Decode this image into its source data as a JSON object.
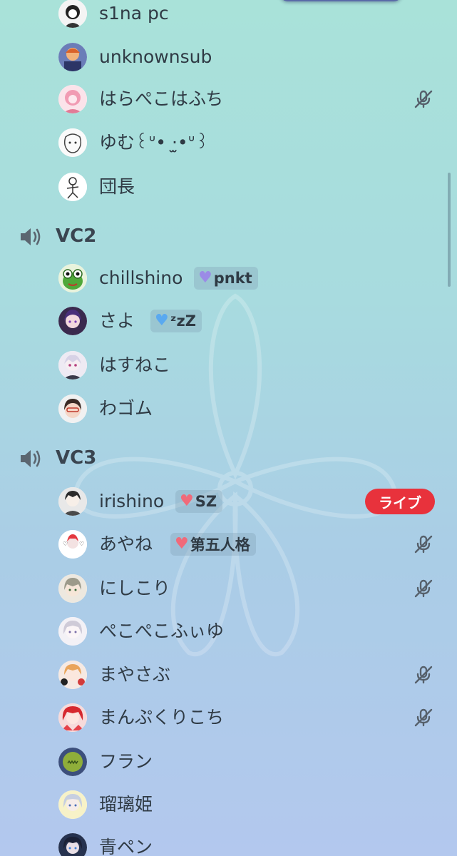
{
  "voice_section_top": {
    "members": [
      {
        "name": "s1na pc",
        "muted": false
      },
      {
        "name": "unknownsub",
        "muted": false
      },
      {
        "name": "はらぺこはふち",
        "muted": true
      },
      {
        "name": "ゆむ꒰ᐡ• ·̫•ᐡ꒱",
        "muted": false
      },
      {
        "name": "団長",
        "muted": false
      }
    ]
  },
  "channels": [
    {
      "name": "VC2",
      "members": [
        {
          "name": "chillshino",
          "badge": "pnkt",
          "badge_heart_color": "#9b8be6"
        },
        {
          "name": "さよ",
          "badge": "ᶻzZ",
          "badge_heart_color": "#5aa9f0"
        },
        {
          "name": "はすねこ"
        },
        {
          "name": "わゴム"
        }
      ]
    },
    {
      "name": "VC3",
      "members": [
        {
          "name": "irishino",
          "badge": "SZ",
          "badge_heart_color": "#f06a7a",
          "live_label": "ライブ"
        },
        {
          "name": "あやね",
          "badge": "第五人格",
          "badge_heart_color": "#f06a7a",
          "muted": true
        },
        {
          "name": "にしこり",
          "muted": true
        },
        {
          "name": "ぺこぺこふぃゆ"
        },
        {
          "name": "まやさぶ",
          "muted": true
        },
        {
          "name": "まんぷくりこち",
          "muted": true
        },
        {
          "name": "フラン"
        },
        {
          "name": "瑠璃姫"
        },
        {
          "name": "青ペン"
        }
      ]
    }
  ],
  "colors": {
    "live": "#e8323c",
    "text": "#2f3a44"
  },
  "icons": {
    "channel": "speaker-icon",
    "mute": "mic-off-icon"
  }
}
